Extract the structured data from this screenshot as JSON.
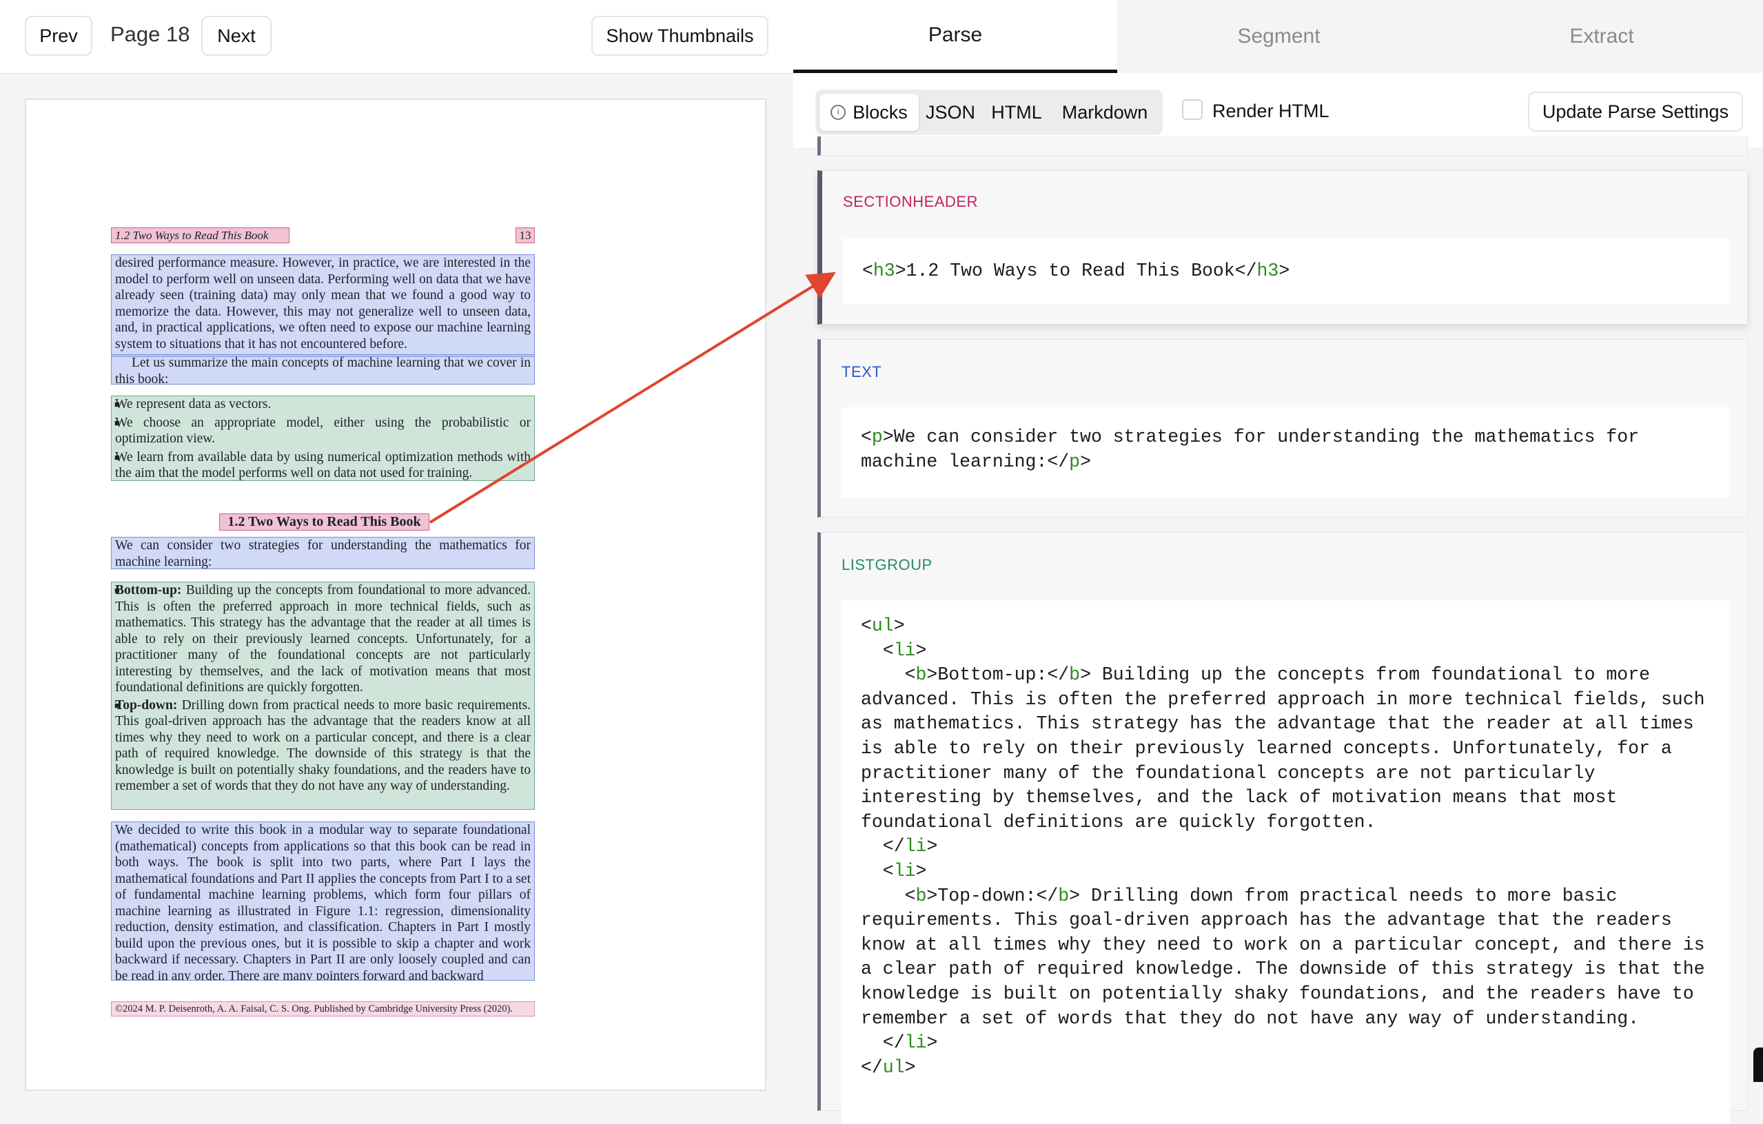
{
  "viewer": {
    "prev_label": "Prev",
    "page_label": "Page 18",
    "next_label": "Next",
    "thumbnails_label": "Show Thumbnails"
  },
  "pdf_page": {
    "running_header": "1.2  Two Ways to Read This Book",
    "page_number": "13",
    "para1": "desired performance measure. However, in practice, we are interested in the model to perform well on unseen data. Performing well on data that we have already seen (training data) may only mean that we found a good way to memorize the data. However, this may not generalize well to unseen data, and, in practical applications, we often need to expose our machine learning system to situations that it has not encountered before.",
    "para2": "Let us summarize the main concepts of machine learning that we cover in this book:",
    "list1": [
      "We represent data as vectors.",
      "We choose an appropriate model, either using the probabilistic or optimization view.",
      "We learn from available data by using numerical optimization methods with the aim that the model performs well on data not used for training."
    ],
    "section_heading": "1.2  Two Ways to Read This Book",
    "para3": "We can consider two strategies for understanding the mathematics for machine learning:",
    "list2": [
      {
        "bold": "Bottom-up:",
        "text": " Building up the concepts from foundational to more advanced. This is often the preferred approach in more technical fields, such as mathematics. This strategy has the advantage that the reader at all times is able to rely on their previously learned concepts. Unfortunately, for a practitioner many of the foundational concepts are not particularly interesting by themselves, and the lack of motivation means that most foundational definitions are quickly forgotten."
      },
      {
        "bold": "Top-down:",
        "text": " Drilling down from practical needs to more basic requirements. This goal-driven approach has the advantage that the readers know at all times why they need to work on a particular concept, and there is a clear path of required knowledge. The downside of this strategy is that the knowledge is built on potentially shaky foundations, and the readers have to remember a set of words that they do not have any way of understanding."
      }
    ],
    "para4": "We decided to write this book in a modular way to separate foundational (mathematical) concepts from applications so that this book can be read in both ways. The book is split into two parts, where Part I lays the mathematical foundations and Part II applies the concepts from Part I to a set of fundamental machine learning problems, which form four pillars of machine learning as illustrated in Figure 1.1: regression, dimensionality reduction, density estimation, and classification. Chapters in Part I mostly build upon the previous ones, but it is possible to skip a chapter and work backward if necessary. Chapters in Part II are only loosely coupled and can be read in any order. There are many pointers forward and backward",
    "footer": "©2024 M. P. Deisenroth, A. A. Faisal, C. S. Ong. Published by Cambridge University Press (2020)."
  },
  "tabs": [
    "Parse",
    "Segment",
    "Extract"
  ],
  "active_tab": "Parse",
  "view_modes": [
    "Blocks",
    "JSON",
    "HTML",
    "Markdown"
  ],
  "active_view": "Blocks",
  "render_html_label": "Render HTML",
  "update_button": "Update Parse Settings",
  "blocks": [
    {
      "type": "SECTIONHEADER",
      "color": "#c0235f"
    },
    {
      "type": "TEXT",
      "color": "#2b59c3"
    },
    {
      "type": "LISTGROUP",
      "color": "#2a8a66"
    }
  ],
  "colors": {
    "arrow": "#e0452f",
    "code_tag": "#2e8b1e",
    "active_tab_underline": "#111111"
  }
}
